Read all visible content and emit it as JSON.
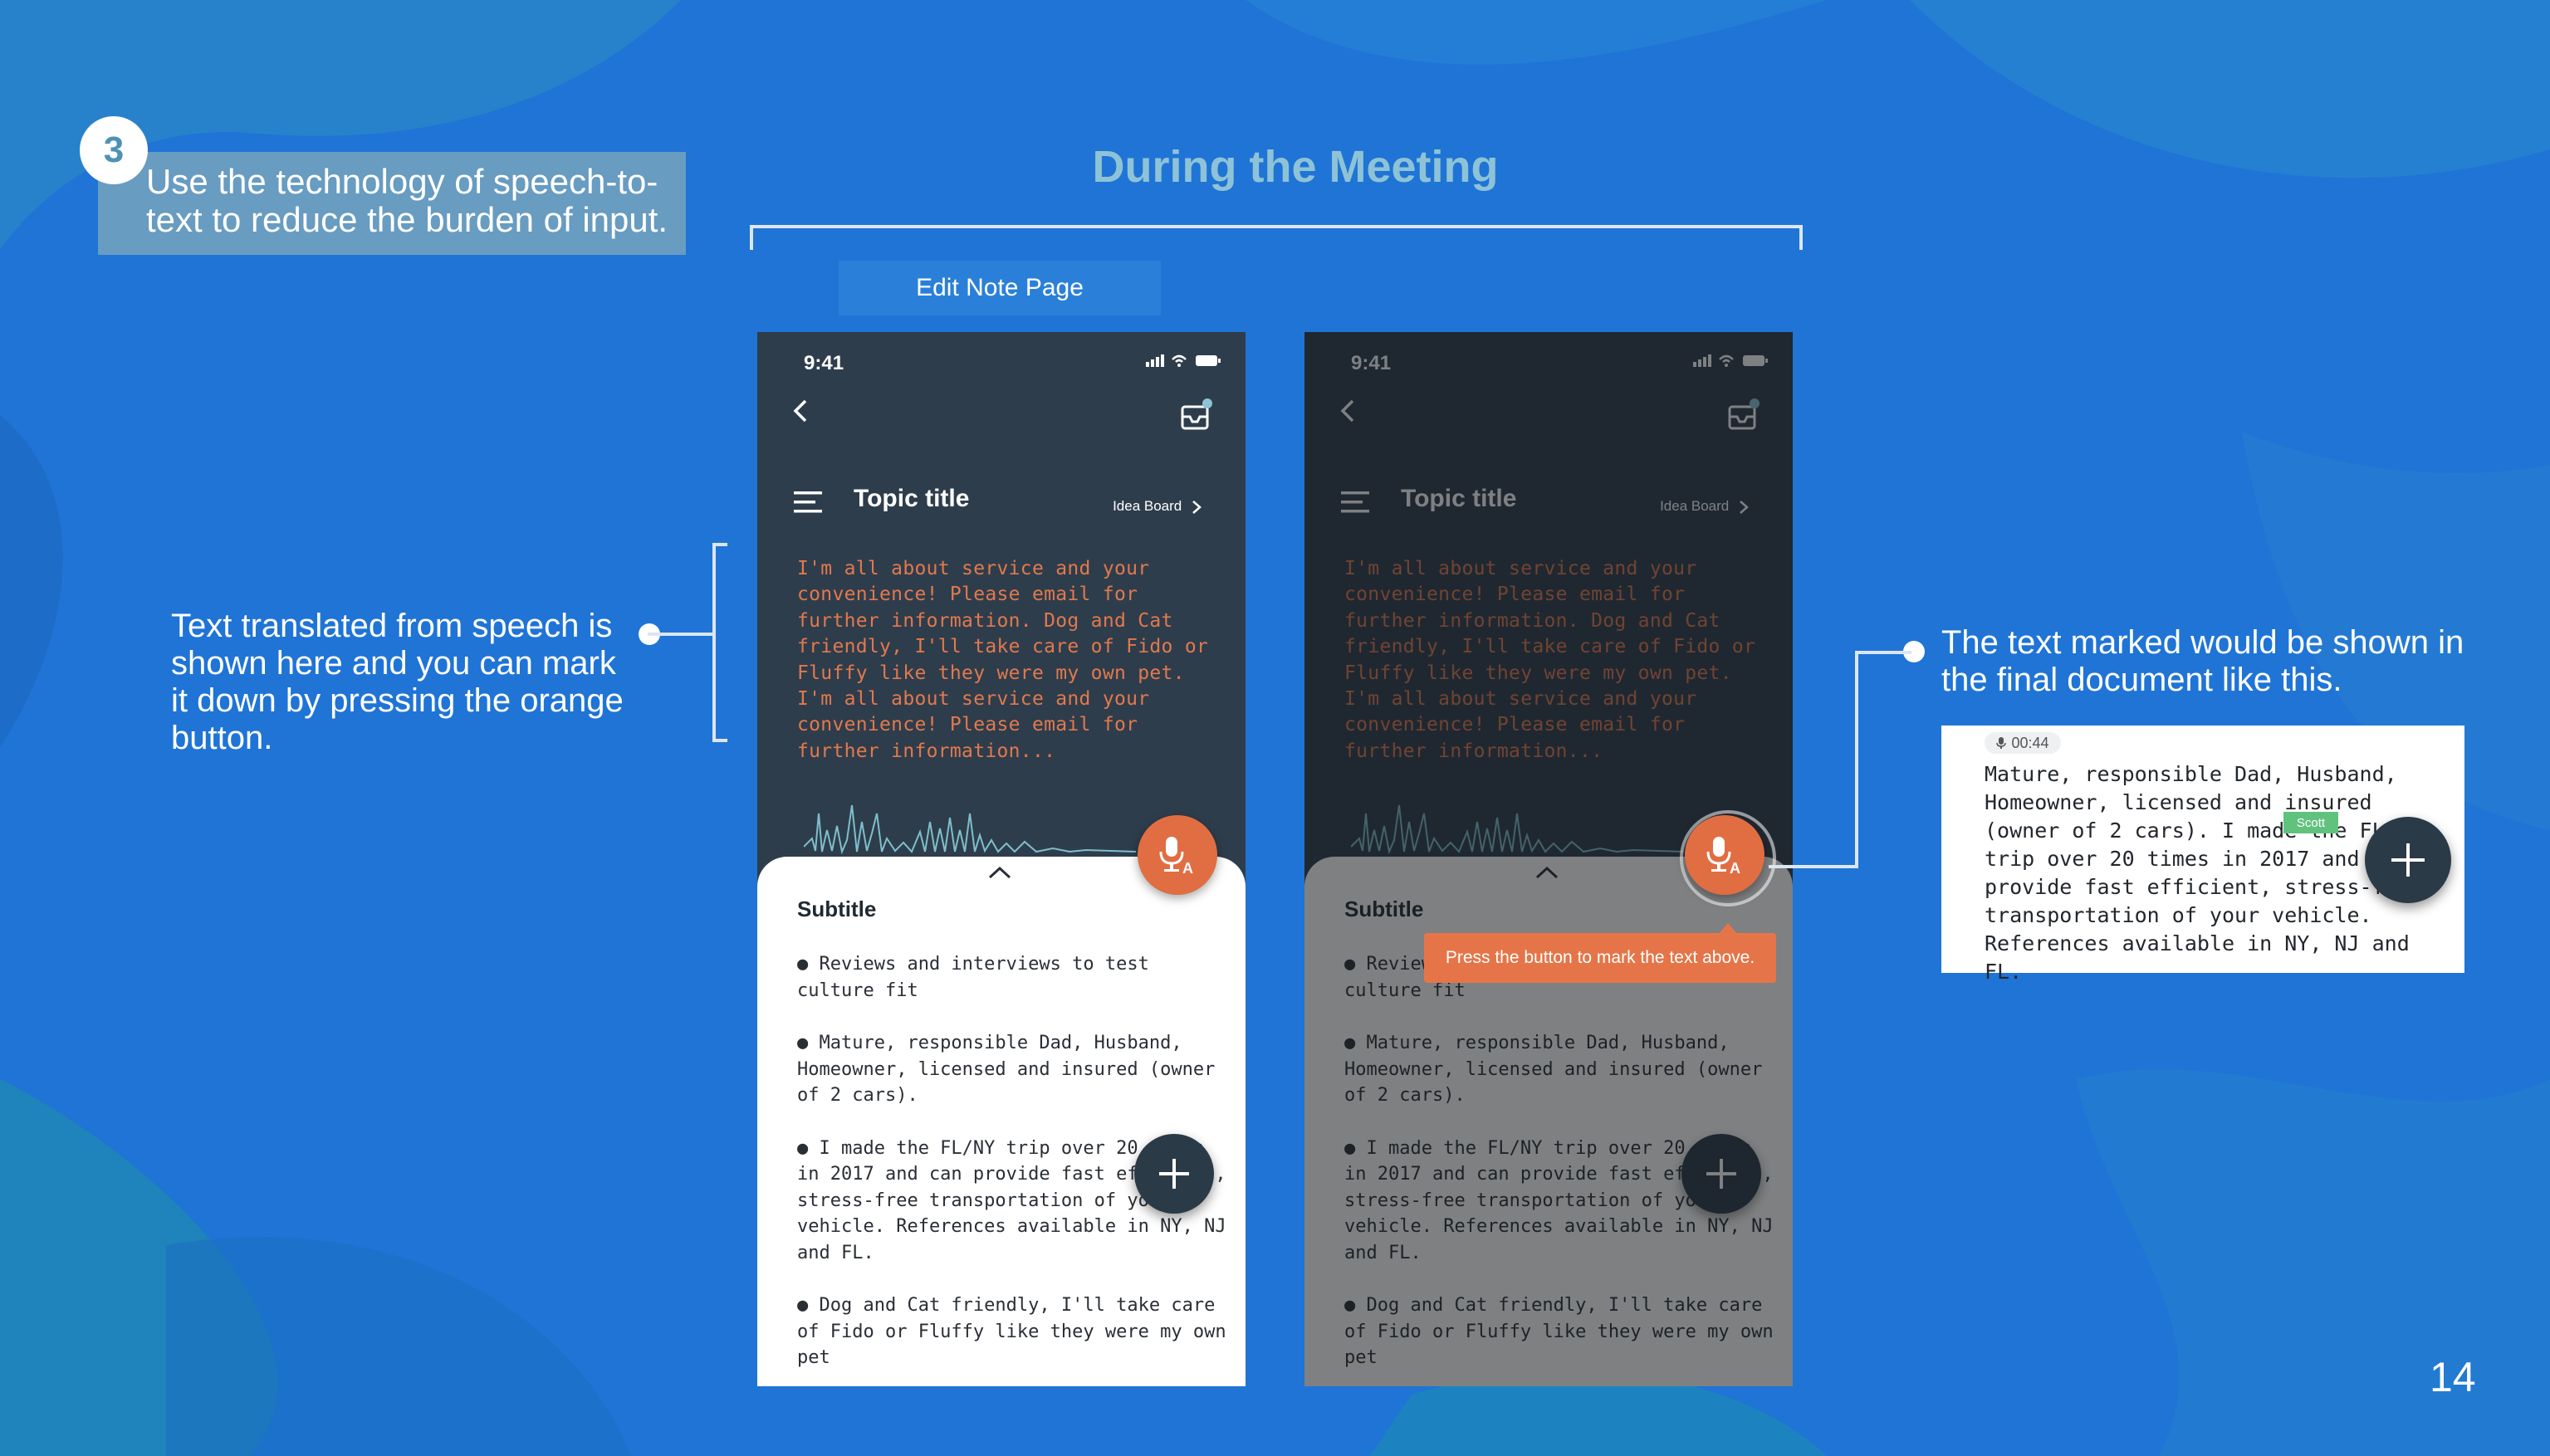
{
  "slide": {
    "step_number": "3",
    "step_text": "Use the technology of speech-to-text to reduce the burden of input.",
    "meeting_title": "During the Meeting",
    "edit_label": "Edit Note Page",
    "left_annotation": "Text translated from speech is shown here and you can mark it down by pressing the orange button.",
    "right_annotation": "The text marked would be shown in the final document like this.",
    "page_number": "14"
  },
  "phone": {
    "time": "9:41",
    "topic_title": "Topic title",
    "idea_board": "Idea Board",
    "transcript": "I'm all about service and your convenience! Please email for further information. Dog and Cat friendly, I'll take care of Fido or Fluffy like they were my own pet. I'm all about service and your convenience! Please email for further information...",
    "subtitle": "Subtitle",
    "bullets": [
      "● Reviews and interviews to test culture fit",
      "● Mature, responsible Dad, Husband, Homeowner, licensed and insured (owner of 2 cars).",
      "● I made the FL/NY trip over 20 times in 2017 and can provide fast efficient, stress-free transportation of your vehicle. References available in NY, NJ and FL.",
      "● Dog and Cat friendly, I'll take care of Fido or Fluffy like they were my own pet"
    ],
    "tooltip": "Press the button to mark the text above."
  },
  "doc": {
    "badge": "00:44",
    "text": "Mature, responsible Dad, Husband, Homeowner, licensed and insured (owner of 2 cars). I made the FL/NY trip over 20 times in 2017 and can provide fast efficient, stress-free transportation of your vehicle. References available in NY, NJ and FL.",
    "mark_label": "Scott"
  },
  "colors": {
    "background": "#1f74d6",
    "phone_dark": "#2e3d4c",
    "accent_orange": "#e06e42",
    "transcript_orange": "#e2794d",
    "mark_green": "#61c27e",
    "heading_teal": "#8ec3d7"
  },
  "icons": [
    "back-icon",
    "inbox-icon",
    "menu-icon",
    "chevron-right-icon",
    "chevron-up-icon",
    "mic-translate-icon",
    "plus-icon",
    "mic-small-icon"
  ]
}
